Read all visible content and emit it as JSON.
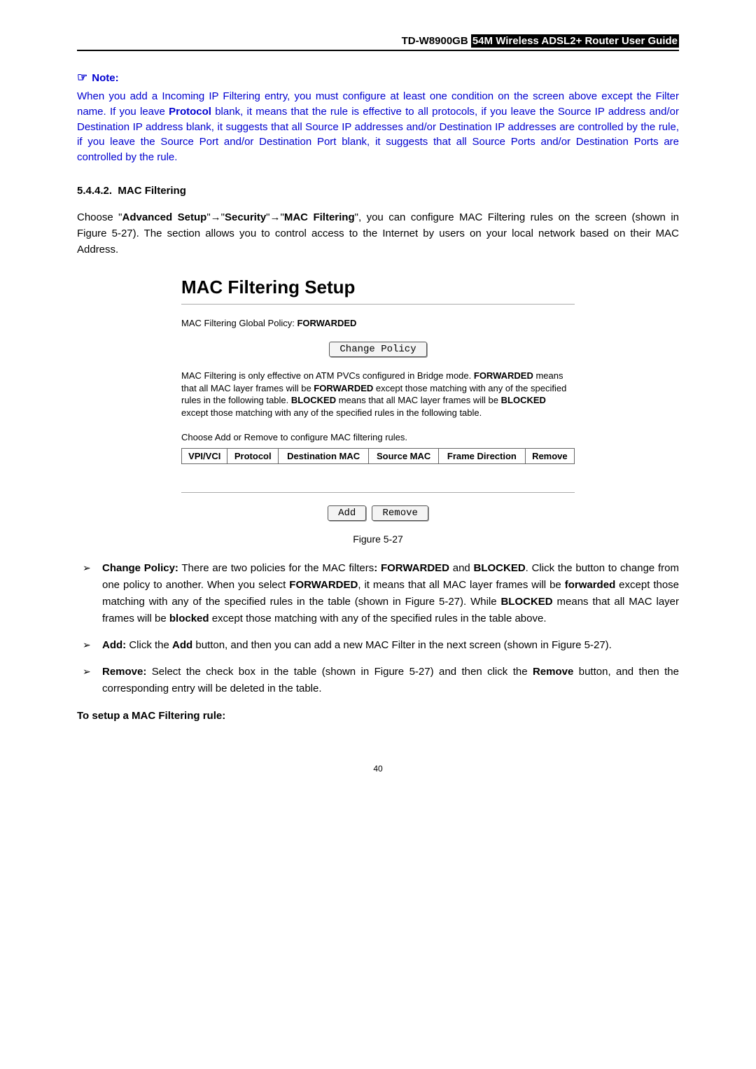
{
  "header": {
    "model": "TD-W8900GB",
    "rest": "54M  Wireless  ADSL2+  Router  User  Guide"
  },
  "note": {
    "label": "Note:",
    "body": "When you add a Incoming IP Filtering entry, you must configure at least one condition on the screen above except the Filter name. If you leave Protocol blank, it means that the rule is effective to all protocols, if you leave the Source IP address and/or Destination IP address blank, it suggests that all Source IP addresses and/or Destination IP addresses are controlled by the rule, if you leave the Source Port and/or Destination Port blank, it suggests that all Source Ports and/or Destination Ports are controlled by the rule."
  },
  "section": {
    "num": "5.4.4.2.",
    "title": "MAC Filtering"
  },
  "intro": {
    "pre": "Choose \"",
    "adv": "Advanced Setup",
    "mid1": "\"→\"",
    "sec": "Security",
    "mid2": "\"→\"",
    "mf": "MAC Filtering",
    "rest": "\", you can configure MAC Filtering rules on the screen (shown in Figure 5-27). The section allows you to control access to the Internet by users on your local network based on their MAC Address."
  },
  "figure": {
    "title": "MAC Filtering Setup",
    "policy_line_pre": "MAC Filtering Global Policy: ",
    "policy_value": "FORWARDED",
    "change_btn": "Change Policy",
    "desc_pre": "MAC Filtering is only effective on ATM PVCs configured in Bridge mode. ",
    "desc_f1": "FORWARDED",
    "desc_mid1": " means that all MAC layer frames will be ",
    "desc_f2": "FORWARDED",
    "desc_mid2": " except those matching with any of the specified rules in the following table. ",
    "desc_b1": "BLOCKED",
    "desc_mid3": " means that all MAC layer frames will be ",
    "desc_b2": "BLOCKED",
    "desc_end": " except those matching with any of the specified rules in the following table.",
    "choose": "Choose Add or Remove to configure MAC filtering rules.",
    "headers": [
      "VPI/VCI",
      "Protocol",
      "Destination MAC",
      "Source MAC",
      "Frame Direction",
      "Remove"
    ],
    "add_btn": "Add",
    "remove_btn": "Remove"
  },
  "caption": "Figure 5-27",
  "bullets": {
    "b1_label": "Change Policy:",
    "b1_t1": " There are two policies for the MAC filters",
    "b1_t2": ": FORWARDED",
    "b1_t3": " and ",
    "b1_t4": "BLOCKED",
    "b1_t5": ". Click the button to change from one policy to another. When you select ",
    "b1_t6": "FORWARDED",
    "b1_t7": ", it means that all MAC layer frames will be ",
    "b1_t8": "forwarded",
    "b1_t9": " except those matching with any of the specified rules in the table (shown in Figure 5-27). While ",
    "b1_t10": "BLOCKED",
    "b1_t11": " means that all MAC layer frames will be ",
    "b1_t12": "blocked",
    "b1_t13": " except those matching with any of the specified rules in the table above.",
    "b2_label": "Add:",
    "b2_t1": " Click the ",
    "b2_t2": "Add",
    "b2_t3": " button, and then you can add a new MAC Filter in the next screen (shown in Figure 5-27).",
    "b3_label": "Remove:",
    "b3_t1": " Select the check box in the table (shown in Figure 5-27) and then click the ",
    "b3_t2": "Remove",
    "b3_t3": " button, and then the corresponding entry will be deleted in the table."
  },
  "setup_rule": "To setup a MAC Filtering rule:",
  "page_num": "40"
}
